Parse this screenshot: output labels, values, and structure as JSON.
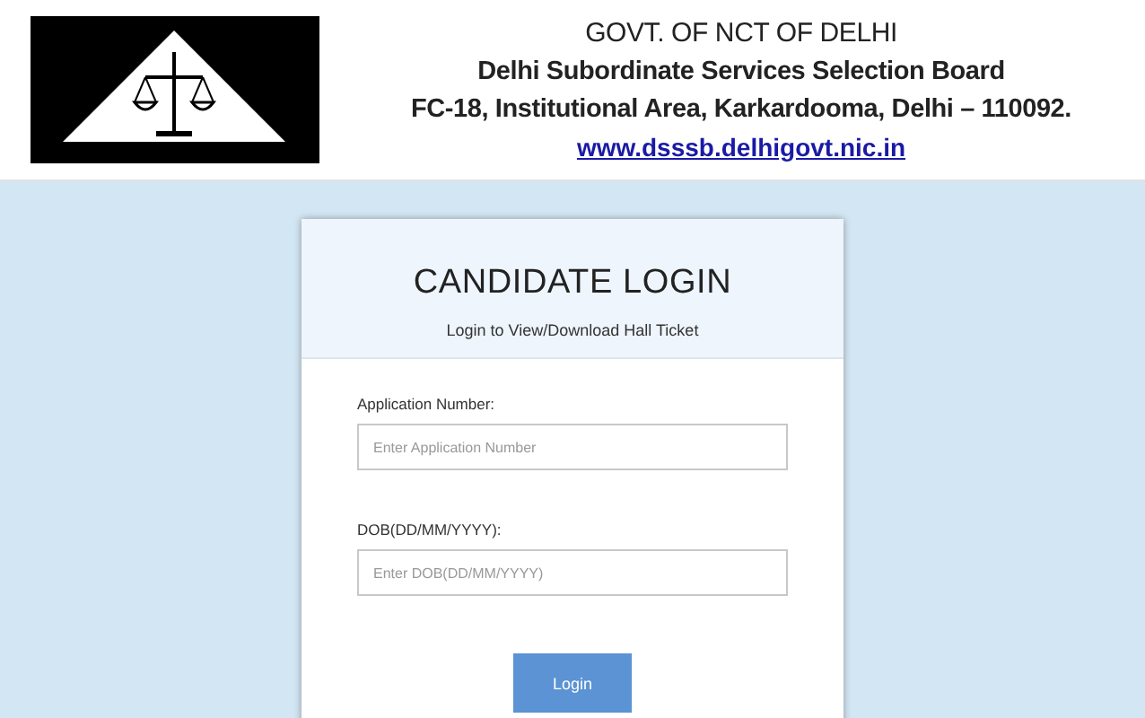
{
  "header": {
    "lines": [
      "GOVT. OF NCT OF DELHI",
      "Delhi Subordinate Services Selection Board",
      "FC-18, Institutional Area, Karkardooma, Delhi – 110092."
    ],
    "link": "www.dsssb.delhigovt.nic.in"
  },
  "login": {
    "title": "CANDIDATE LOGIN",
    "subtitle": "Login to View/Download Hall Ticket",
    "fields": [
      {
        "label": "Application Number:",
        "placeholder": "Enter Application Number"
      },
      {
        "label": "DOB(DD/MM/YYYY):",
        "placeholder": "Enter DOB(DD/MM/YYYY)"
      }
    ],
    "button": "Login"
  }
}
